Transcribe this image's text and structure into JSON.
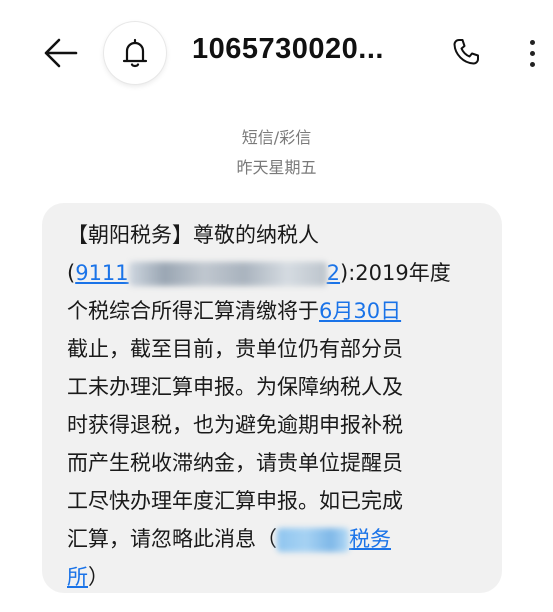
{
  "header": {
    "title": "1065730020...",
    "back_icon": "arrow-left-icon",
    "bell_icon": "bell-icon",
    "phone_icon": "phone-icon",
    "more_icon": "more-vertical-icon"
  },
  "message_meta": {
    "type_label": "短信/彩信",
    "date_label": "昨天星期五"
  },
  "message": {
    "line1": "【朝阳税务】尊敬的纳税人",
    "line2_open": "(",
    "line2_link_visible": "9111",
    "line2_link_tail": "2",
    "line2_text": "):2019年度",
    "line3_text": "个税综合所得汇算清缴将于",
    "line3_link": "6月30日",
    "line4": "截止，截至目前，贵单位仍有部分员",
    "line5": "工未办理汇算申报。为保障纳税人及",
    "line6": "时获得退税，也为避免逾期申报补税",
    "line7": "而产生税收滞纳金，请贵单位提醒员",
    "line8": "工尽快办理年度汇算申报。如已完成",
    "line9_text": "汇算，请忽略此消息（",
    "line9_link": "税务",
    "line10_link": "所",
    "line10_text": "）"
  },
  "colors": {
    "link": "#1a73e8",
    "bubble": "#f1f1f1",
    "meta_text": "#7a7a7a"
  }
}
